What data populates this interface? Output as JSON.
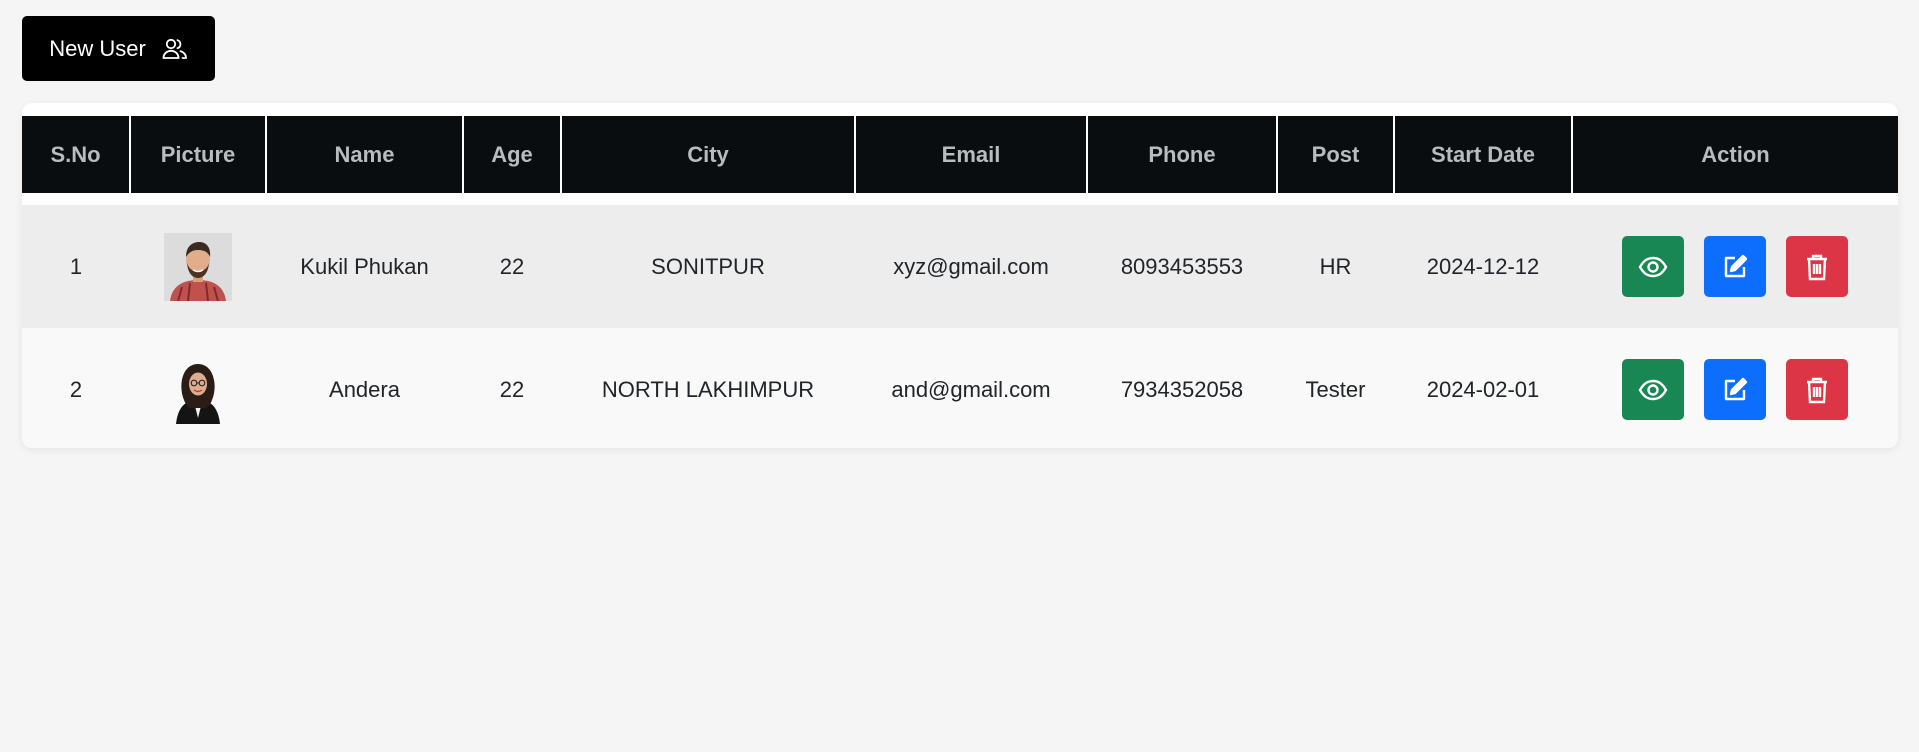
{
  "toolbar": {
    "new_user_label": "New User"
  },
  "table": {
    "headers": {
      "sno": "S.No",
      "picture": "Picture",
      "name": "Name",
      "age": "Age",
      "city": "City",
      "email": "Email",
      "phone": "Phone",
      "post": "Post",
      "start_date": "Start Date",
      "action": "Action"
    },
    "rows": [
      {
        "sno": "1",
        "name": "Kukil Phukan",
        "age": "22",
        "city": "SONITPUR",
        "email": "xyz@gmail.com",
        "phone": "8093453553",
        "post": "HR",
        "start_date": "2024-12-12",
        "picture_icon": "avatar-man-icon"
      },
      {
        "sno": "2",
        "name": "Andera",
        "age": "22",
        "city": "NORTH LAKHIMPUR",
        "email": "and@gmail.com",
        "phone": "7934352058",
        "post": "Tester",
        "start_date": "2024-02-01",
        "picture_icon": "avatar-woman-icon"
      }
    ]
  },
  "icons": {
    "new_user": "users-icon",
    "view": "eye-icon",
    "edit": "edit-icon",
    "delete": "trash-icon"
  },
  "colors": {
    "view_button": "#198754",
    "edit_button": "#0d6efd",
    "delete_button": "#dc3545",
    "header_bg": "#0a0d10",
    "header_text": "#b9bcbf"
  }
}
